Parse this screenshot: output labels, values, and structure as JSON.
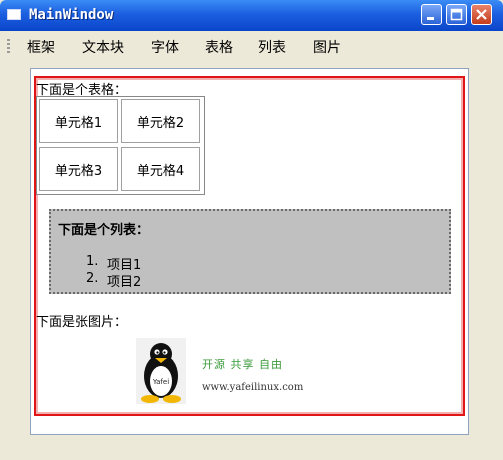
{
  "window": {
    "title": "MainWindow"
  },
  "menubar": {
    "items": [
      "框架",
      "文本块",
      "字体",
      "表格",
      "列表",
      "图片"
    ]
  },
  "document": {
    "table_heading": "下面是个表格：",
    "table": {
      "cells": [
        "单元格1",
        "单元格2",
        "单元格3",
        "单元格4"
      ]
    },
    "list_heading": "下面是个列表：",
    "list_items": [
      {
        "marker": "1.",
        "text": "项目1"
      },
      {
        "marker": "2.",
        "text": "项目2"
      }
    ],
    "image_heading": "下面是张图片：",
    "image": {
      "logo_text": "Yafei",
      "slogan": "开源  共享  自由",
      "url": "www.yafeilinux.com"
    }
  },
  "colors": {
    "frame_border": "#e01515",
    "list_background": "#c0c0c0",
    "titlebar": "#0a45c9"
  }
}
